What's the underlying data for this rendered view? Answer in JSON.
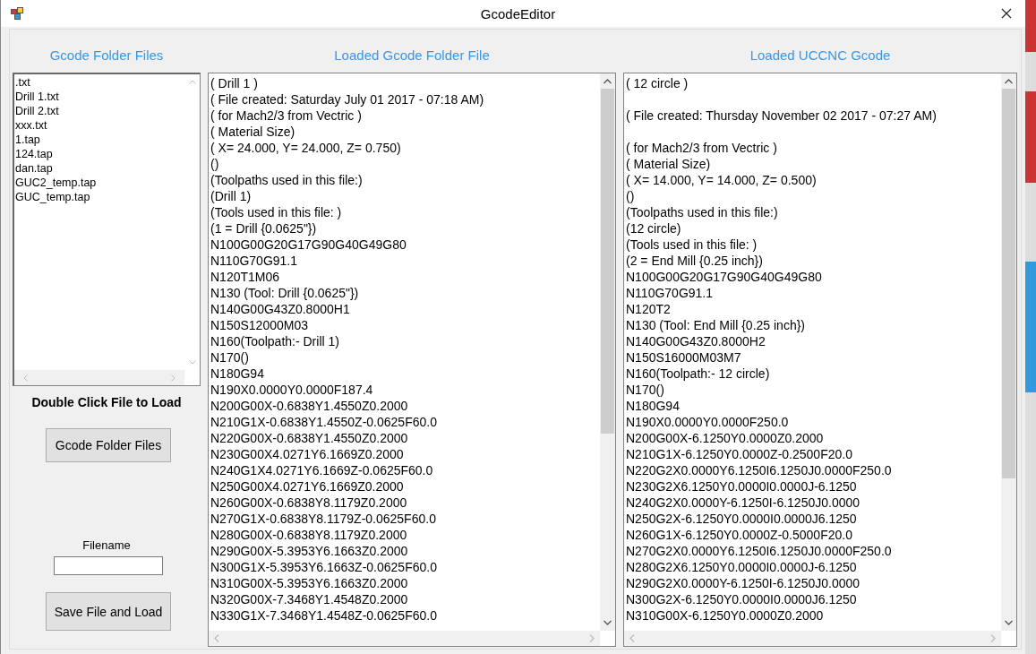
{
  "window": {
    "title": "GcodeEditor"
  },
  "folder_panel": {
    "heading": "Gcode Folder Files",
    "files": [
      ".txt",
      "Drill 1.txt",
      "Drill 2.txt",
      "xxx.txt",
      "1.tap",
      "124.tap",
      "dan.tap",
      "GUC2_temp.tap",
      "GUC_temp.tap"
    ],
    "hint": "Double Click File to Load",
    "folder_button": "Gcode Folder Files",
    "filename_label": "Filename",
    "save_button": "Save File and Load"
  },
  "loaded_file": {
    "heading": "Loaded Gcode Folder File",
    "blocks": [
      [
        "( Drill 1 )",
        "( File created: Saturday July 01 2017 - 07:18 AM)",
        "( for Mach2/3 from Vectric )",
        "( Material Size)",
        "( X= 24.000, Y= 24.000, Z= 0.750)",
        "()",
        "(Toolpaths used in this file:)",
        "(Drill 1)",
        "(Tools used in this file: )",
        "(1 = Drill {0.0625\"})",
        "N100G00G20G17G90G40G49G80",
        "N110G70G91.1",
        "N120T1M06",
        "N130 (Tool: Drill {0.0625\"})",
        "N140G00G43Z0.8000H1",
        "N150S12000M03",
        "N160(Toolpath:- Drill 1)",
        "N170()",
        "N180G94",
        "N190X0.0000Y0.0000F187.4",
        "N200G00X-0.6838Y1.4550Z0.2000",
        "N210G1X-0.6838Y1.4550Z-0.0625F60.0",
        "N220G00X-0.6838Y1.4550Z0.2000",
        "N230G00X4.0271Y6.1669Z0.2000",
        "N240G1X4.0271Y6.1669Z-0.0625F60.0",
        "N250G00X4.0271Y6.1669Z0.2000",
        "N260G00X-0.6838Y8.1179Z0.2000",
        "N270G1X-0.6838Y8.1179Z-0.0625F60.0",
        "N280G00X-0.6838Y8.1179Z0.2000",
        "N290G00X-5.3953Y6.1663Z0.2000",
        "N300G1X-5.3953Y6.1663Z-0.0625F60.0",
        "N310G00X-5.3953Y6.1663Z0.2000",
        "N320G00X-7.3468Y1.4548Z0.2000",
        "N330G1X-7.3468Y1.4548Z-0.0625F60.0"
      ]
    ]
  },
  "uccnc": {
    "heading": "Loaded UCCNC Gcode",
    "blocks": [
      [
        "( 12 circle )"
      ],
      [
        "( File created: Thursday November 02 2017 - 07:27 AM)"
      ],
      [
        "( for Mach2/3 from Vectric )",
        "( Material Size)",
        "( X= 14.000, Y= 14.000, Z= 0.500)",
        "()",
        "(Toolpaths used in this file:)",
        "(12 circle)",
        "(Tools used in this file: )",
        "(2 = End Mill {0.25 inch})",
        "N100G00G20G17G90G40G49G80",
        "N110G70G91.1",
        "N120T2",
        "N130 (Tool: End Mill {0.25 inch})",
        "N140G00G43Z0.8000H2",
        "N150S16000M03M7",
        "N160(Toolpath:- 12 circle)",
        "N170()",
        "N180G94",
        "N190X0.0000Y0.0000F250.0",
        "N200G00X-6.1250Y0.0000Z0.2000",
        "N210G1X-6.1250Y0.0000Z-0.2500F20.0",
        "N220G2X0.0000Y6.1250I6.1250J0.0000F250.0",
        "N230G2X6.1250Y0.0000I0.0000J-6.1250",
        "N240G2X0.0000Y-6.1250I-6.1250J0.0000",
        "N250G2X-6.1250Y0.0000I0.0000J6.1250",
        "N260G1X-6.1250Y0.0000Z-0.5000F20.0",
        "N270G2X0.0000Y6.1250I6.1250J0.0000F250.0",
        "N280G2X6.1250Y0.0000I0.0000J-6.1250",
        "N290G2X0.0000Y-6.1250I-6.1250J0.0000",
        "N300G2X-6.1250Y0.0000I0.0000J6.1250",
        "N310G00X-6.1250Y0.0000Z0.2000"
      ]
    ]
  }
}
